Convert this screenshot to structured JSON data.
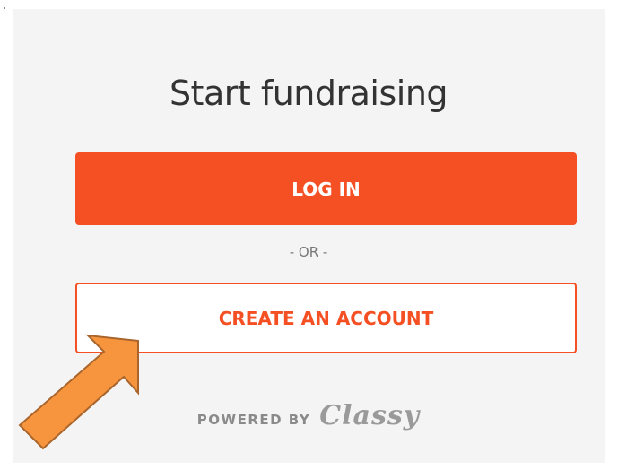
{
  "title": "Start fundraising",
  "login_label": "LOG IN",
  "or_label": "- OR -",
  "create_label": "CREATE AN ACCOUNT",
  "powered_by": "POWERED BY",
  "brand_logo_text": "Classy",
  "colors": {
    "accent": "#f55024",
    "panel_bg": "#f4f4f4",
    "arrow_fill": "#f7953f",
    "arrow_stroke": "#a9652b"
  },
  "icons": {
    "annotation": "arrow-annotation-icon"
  }
}
